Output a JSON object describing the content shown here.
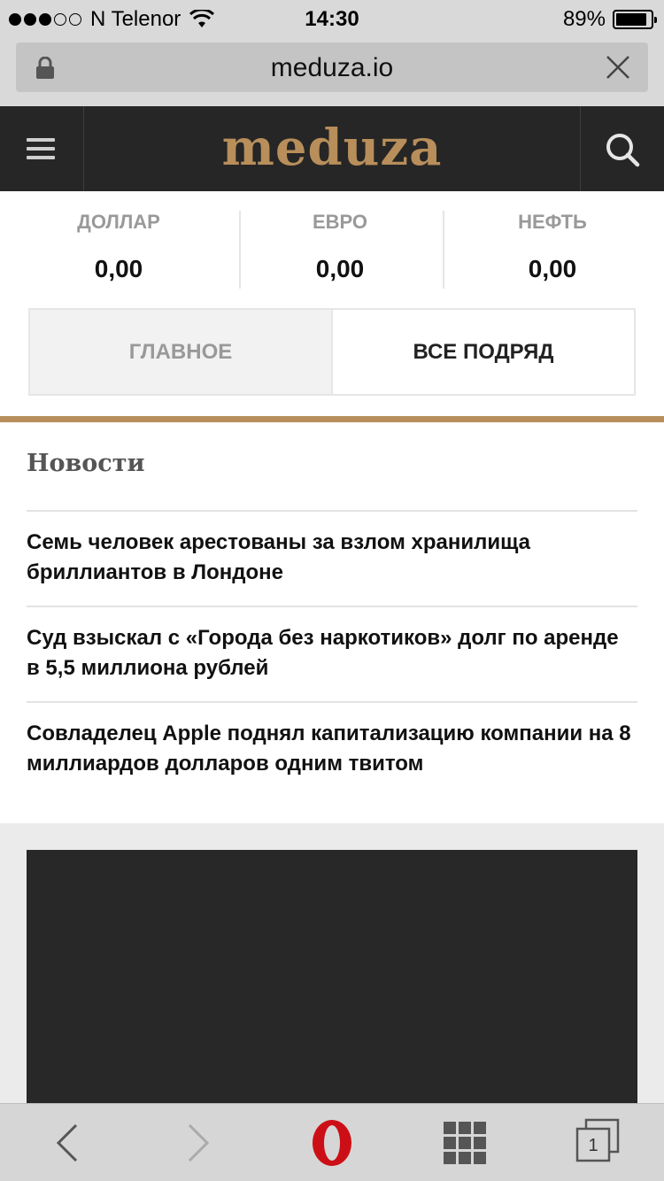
{
  "status_bar": {
    "carrier": "N Telenor",
    "time": "14:30",
    "battery_percent_label": "89%",
    "battery_level": 0.89
  },
  "url_bar": {
    "url": "meduza.io"
  },
  "header": {
    "logo": "meduza"
  },
  "rates": [
    {
      "label": "ДОЛЛАР",
      "value": "0,00"
    },
    {
      "label": "ЕВРО",
      "value": "0,00"
    },
    {
      "label": "НЕФТЬ",
      "value": "0,00"
    }
  ],
  "tabs": [
    {
      "label": "ГЛАВНОЕ",
      "active": false
    },
    {
      "label": "ВСЕ ПОДРЯД",
      "active": true
    }
  ],
  "news": {
    "title": "Новости",
    "items": [
      "Семь человек арестованы за взлом хранилища бриллиантов в Лондоне",
      "Суд взыскал с «Города без наркотиков» долг по аренде в 5,5 миллиона рублей",
      "Совладелец Apple поднял капитализацию компании на 8 миллиардов долларов одним твитом"
    ]
  },
  "toolbar": {
    "tabs_count": "1"
  },
  "colors": {
    "accent": "#b88e5a",
    "header_bg": "#262626",
    "opera_red": "#cc0f16"
  }
}
